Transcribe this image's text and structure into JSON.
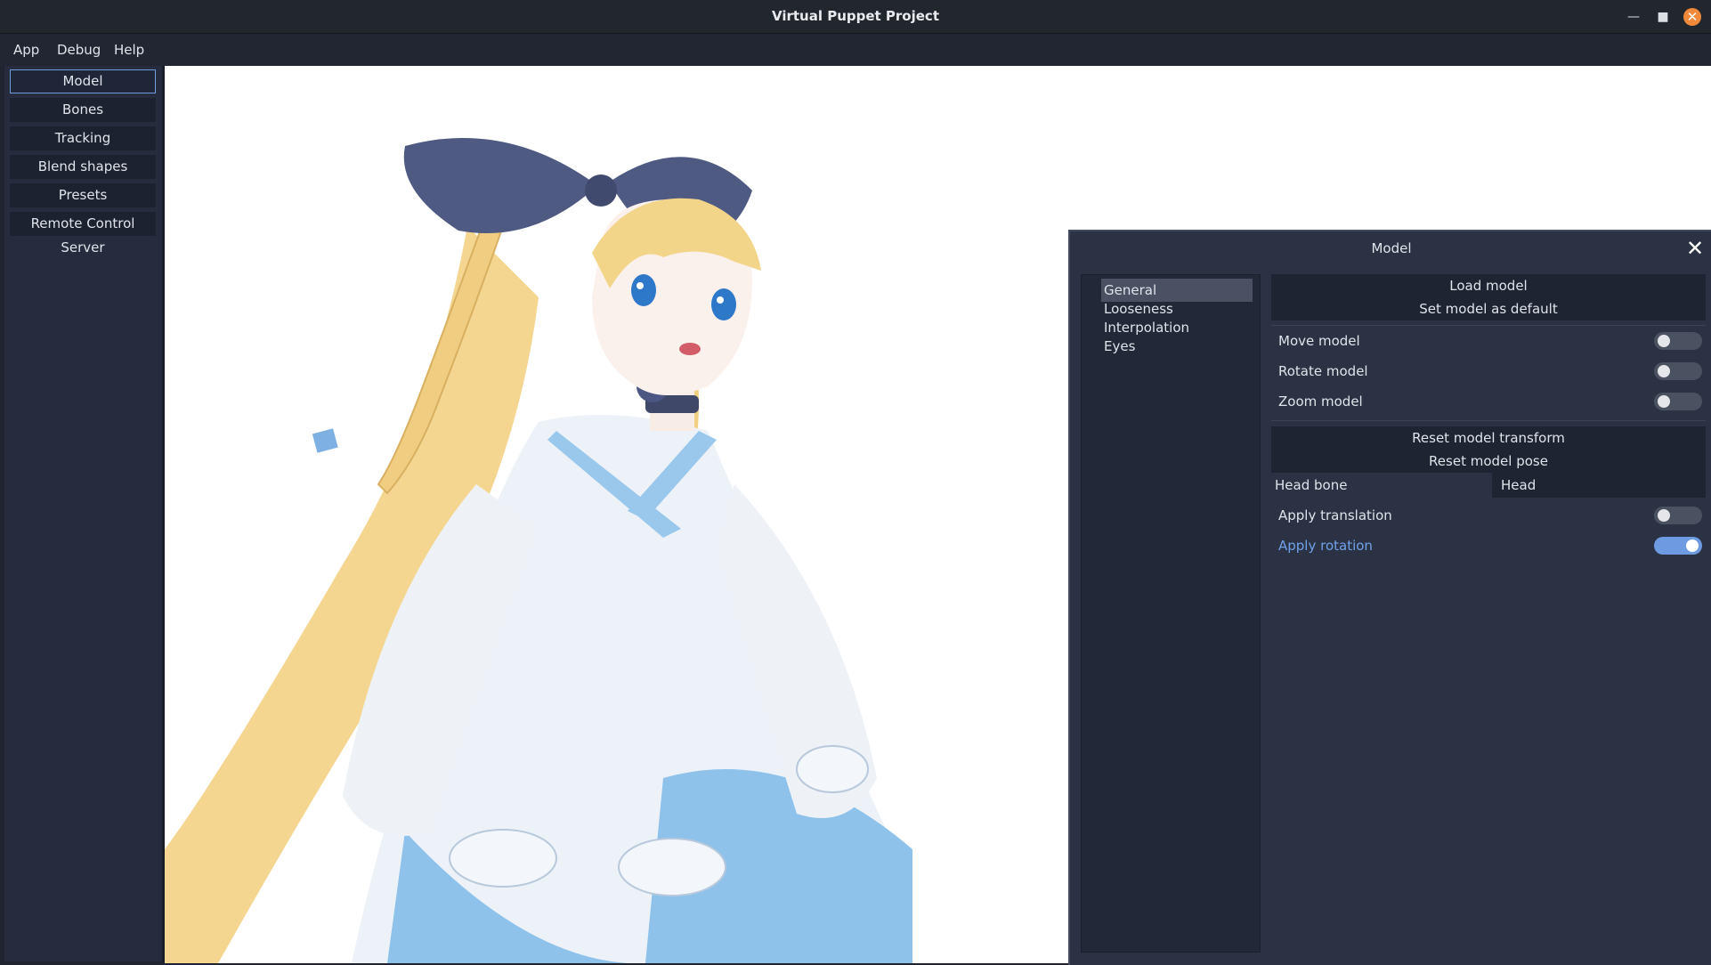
{
  "window": {
    "title": "Virtual Puppet Project",
    "accent_color": "#f0893a"
  },
  "menubar": {
    "items": [
      {
        "label": "App"
      },
      {
        "label": "Debug"
      },
      {
        "label": "Help"
      }
    ]
  },
  "sidebar": {
    "buttons": [
      {
        "label": "Model",
        "active": true
      },
      {
        "label": "Bones"
      },
      {
        "label": "Tracking"
      },
      {
        "label": "Blend shapes"
      },
      {
        "label": "Presets"
      },
      {
        "label": "Remote Control Server"
      }
    ]
  },
  "viewport": {
    "content": "3D anime character model"
  },
  "panel": {
    "title": "Model",
    "tree": [
      {
        "label": "General",
        "selected": true
      },
      {
        "label": "Looseness"
      },
      {
        "label": "Interpolation"
      },
      {
        "label": "Eyes"
      }
    ],
    "load_model": "Load model",
    "set_default": "Set model as default",
    "toggles_top": [
      {
        "label": "Move model",
        "on": false
      },
      {
        "label": "Rotate model",
        "on": false
      },
      {
        "label": "Zoom model",
        "on": false
      }
    ],
    "reset_transform": "Reset model transform",
    "reset_pose": "Reset model pose",
    "head_bone": {
      "label": "Head bone",
      "value": "Head"
    },
    "toggles_bottom": [
      {
        "label": "Apply translation",
        "on": false
      },
      {
        "label": "Apply rotation",
        "on": true
      }
    ],
    "toggle_on_color": "#6d9ae0"
  }
}
